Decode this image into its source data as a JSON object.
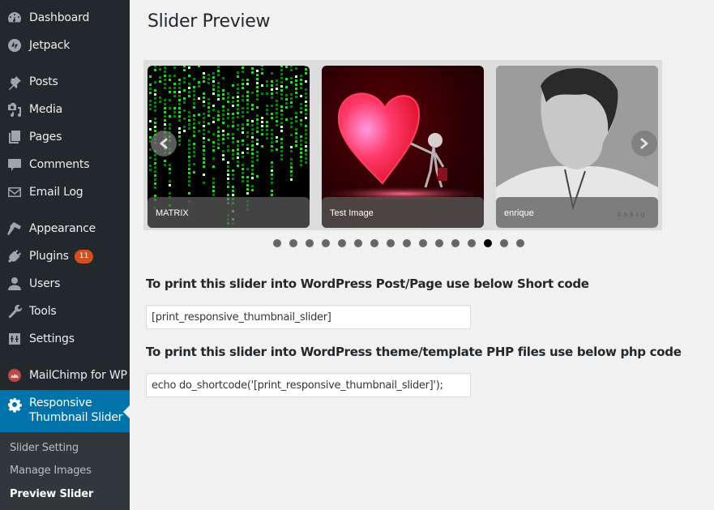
{
  "sidebar": {
    "items": [
      {
        "label": "Dashboard",
        "icon": "dashboard-icon"
      },
      {
        "label": "Jetpack",
        "icon": "jetpack-icon"
      },
      {
        "label": "Posts",
        "icon": "pin-icon"
      },
      {
        "label": "Media",
        "icon": "media-icon"
      },
      {
        "label": "Pages",
        "icon": "pages-icon"
      },
      {
        "label": "Comments",
        "icon": "comment-icon"
      },
      {
        "label": "Email Log",
        "icon": "envelope-icon"
      },
      {
        "label": "Appearance",
        "icon": "paintbrush-icon"
      },
      {
        "label": "Plugins",
        "icon": "plug-icon",
        "badge": "11"
      },
      {
        "label": "Users",
        "icon": "user-icon"
      },
      {
        "label": "Tools",
        "icon": "wrench-icon"
      },
      {
        "label": "Settings",
        "icon": "settings-sliders-icon"
      },
      {
        "label": "MailChimp for WP",
        "icon": "mailchimp-icon"
      }
    ],
    "current": {
      "label_line1": "Responsive",
      "label_line2": "Thumbnail Slider",
      "icon": "gear-icon"
    },
    "submenu": [
      {
        "label": "Slider Setting",
        "active": false
      },
      {
        "label": "Manage Images",
        "active": false
      },
      {
        "label": "Preview Slider",
        "active": true
      }
    ]
  },
  "main": {
    "title": "Slider Preview",
    "slider": {
      "slides": [
        {
          "caption": "MATRIX",
          "image": "green matrix code rain"
        },
        {
          "caption": "Test Image",
          "image": "red heart with stick figure"
        },
        {
          "caption": "enrique",
          "image": "black and white portrait"
        }
      ],
      "prev_icon": "chevron-left-icon",
      "next_icon": "chevron-right-icon",
      "dot_count": 16,
      "active_dot": 13
    },
    "shortcode_label": "To print this slider into WordPress Post/Page use below Short code",
    "shortcode_value": "[print_responsive_thumbnail_slider]",
    "php_label": "To print this slider into WordPress theme/template PHP files use below php code",
    "php_value": "echo do_shortcode('[print_responsive_thumbnail_slider]');"
  },
  "colors": {
    "sidebar_bg": "#23282d",
    "active_bg": "#0073aa",
    "submenu_bg": "#32373c",
    "badge": "#d54e21",
    "page_bg": "#f1f1f1"
  }
}
